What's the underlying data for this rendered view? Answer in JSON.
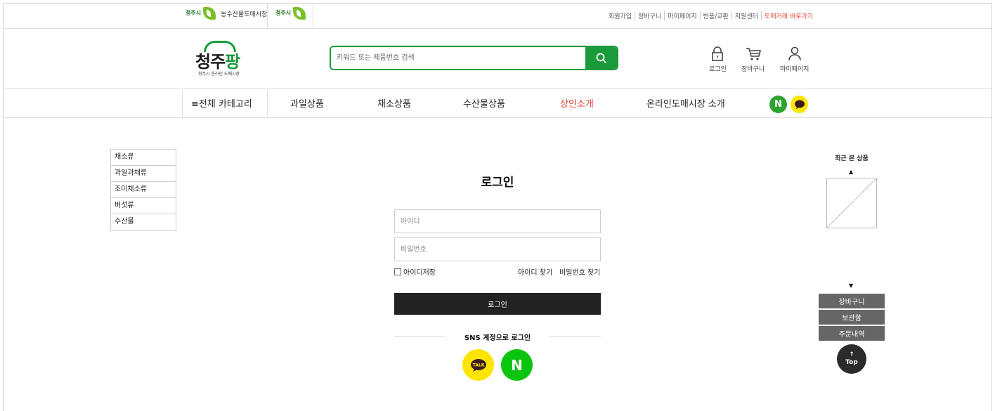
{
  "topbar": {
    "city_logo_1_name": "청주시",
    "city_logo_1_label": "농수산물도매시장",
    "city_logo_2_name": "청주시",
    "links": [
      "회원가입",
      "장바구니",
      "마이페이지",
      "반품/교환",
      "지원센터"
    ],
    "highlight_link": "도매거래 바로가기"
  },
  "header": {
    "logo_main": "청주",
    "logo_accent": "팡",
    "logo_sub": "청주시 온라인 도매시장",
    "search_placeholder": "키워드 또는 제품번호 검색",
    "icons": [
      {
        "icon": "lock-icon",
        "label": "로그인"
      },
      {
        "icon": "cart-icon",
        "label": "장바구니"
      },
      {
        "icon": "user-icon",
        "label": "마이페이지"
      }
    ]
  },
  "nav": {
    "all_category": "≡전체 카테고리",
    "items": [
      "과일상품",
      "채소상품",
      "수산물상품",
      "상인소개",
      "온라인도매시장 소개"
    ],
    "active_color": "#e23c2c",
    "naver_badge": "N"
  },
  "side_categories": [
    "채소류",
    "과일과채류",
    "조미채소류",
    "버섯류",
    "수산물"
  ],
  "login": {
    "title": "로그인",
    "id_placeholder": "아이디",
    "pw_placeholder": "비밀번호",
    "remember_label": "아이디저장",
    "find_id": "아이디 찾기",
    "find_pw": "비밀번호 찾기",
    "login_button": "로그인",
    "sns_label": "SNS 계정으로 로그인",
    "kakao_text": "TALK",
    "naver_text": "N"
  },
  "quick": {
    "recent_title": "최근 본 상품",
    "up_arrow": "▲",
    "down_arrow": "▼",
    "buttons": [
      "장바구니",
      "보관함",
      "주문내역"
    ],
    "top_arrow": "↑",
    "top_label": "Top"
  },
  "colors": {
    "brand_green": "#1b9a3c",
    "kakao_yellow": "#fee500",
    "naver_green": "#03c75a",
    "alert_red": "#e23c2c"
  }
}
